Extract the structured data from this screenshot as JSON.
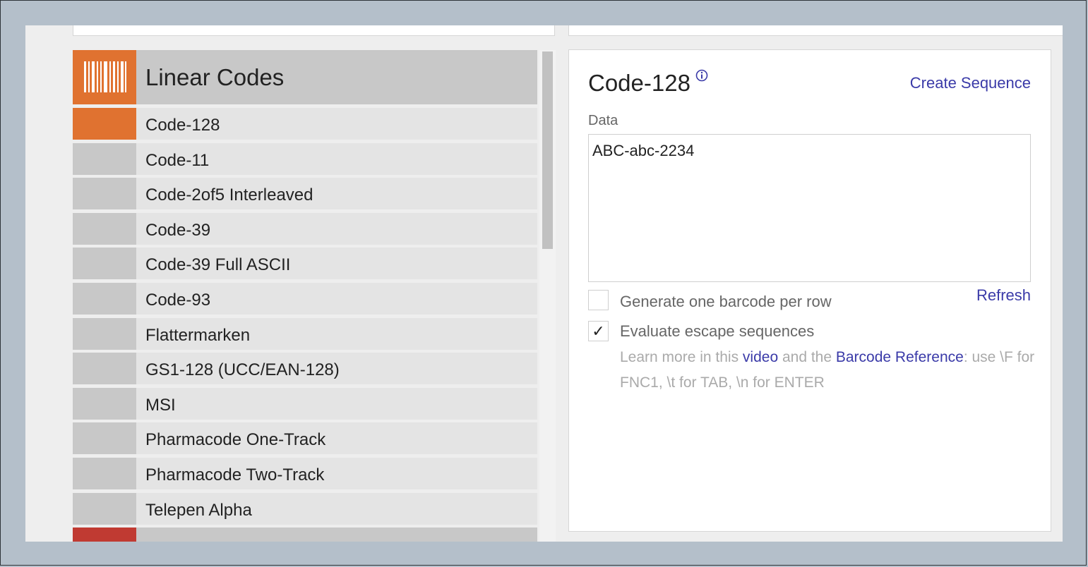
{
  "category": {
    "title": "Linear Codes",
    "icon": "barcode-icon",
    "accent_color": "#e07230"
  },
  "code_list": [
    {
      "label": "Code-128",
      "selected": true
    },
    {
      "label": "Code-11",
      "selected": false
    },
    {
      "label": "Code-2of5 Interleaved",
      "selected": false
    },
    {
      "label": "Code-39",
      "selected": false
    },
    {
      "label": "Code-39 Full ASCII",
      "selected": false
    },
    {
      "label": "Code-93",
      "selected": false
    },
    {
      "label": "Flattermarken",
      "selected": false
    },
    {
      "label": "GS1-128 (UCC/EAN-128)",
      "selected": false
    },
    {
      "label": "MSI",
      "selected": false
    },
    {
      "label": "Pharmacode One-Track",
      "selected": false
    },
    {
      "label": "Pharmacode Two-Track",
      "selected": false
    },
    {
      "label": "Telepen Alpha",
      "selected": false
    }
  ],
  "detail": {
    "title": "Code-128",
    "info_icon": "info-icon",
    "create_sequence_label": "Create Sequence",
    "data_label": "Data",
    "data_value": "ABC-abc-2234",
    "refresh_label": "Refresh",
    "one_per_row": {
      "label": "Generate one barcode per row",
      "checked": false
    },
    "escape_sequences": {
      "label": "Evaluate escape sequences",
      "checked": true,
      "check_glyph": "✓"
    },
    "help": {
      "prefix": "Learn more in this ",
      "video_link": "video",
      "middle": " and the ",
      "reference_link": "Barcode Reference",
      "suffix": ": use \\F for FNC1, \\t for TAB, \\n for ENTER"
    }
  },
  "colors": {
    "link": "#3a3aa8",
    "selected_marker": "#e07230",
    "next_category_marker": "#c03a32"
  }
}
